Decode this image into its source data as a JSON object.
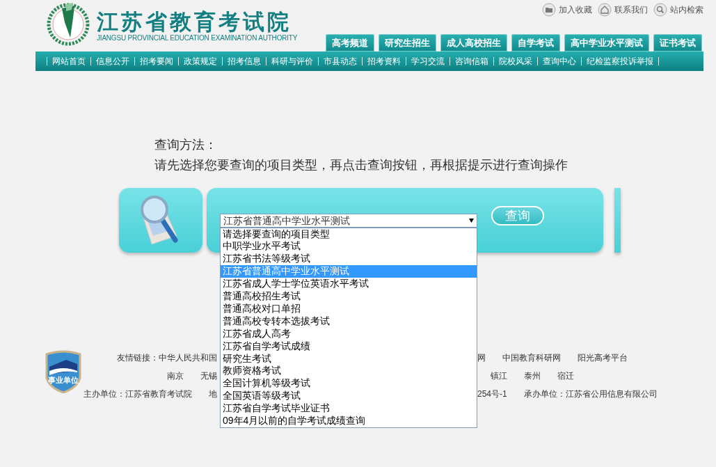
{
  "header": {
    "title": "江苏省教育考试院",
    "subtitle": "JIANGSU PROVINCIAL EDUCATION EXAMINATION AUTHORITY",
    "top_links": [
      {
        "label": "加入收藏",
        "kind": "folder"
      },
      {
        "label": "联系我们",
        "kind": "home"
      },
      {
        "label": "站内检索",
        "kind": "search"
      }
    ],
    "tabs": [
      "高考频道",
      "研究生招生",
      "成人高校招生",
      "自学考试",
      "高中学业水平测试",
      "证书考试"
    ]
  },
  "nav": [
    "网站首页",
    "信息公开",
    "招考要闻",
    "政策规定",
    "招考信息",
    "科研与评价",
    "市县动态",
    "招考资料",
    "学习交流",
    "咨询信箱",
    "院校风采",
    "查询中心",
    "纪检监察投诉举报"
  ],
  "instructions": {
    "heading": "查询方法：",
    "text": "请先选择您要查询的项目类型，再点击查询按钮，再根据提示进行查询操作"
  },
  "query": {
    "select_value": "江苏省普通高中学业水平测试",
    "button": "查询",
    "options": [
      {
        "label": "请选择要查询的项目类型",
        "selected": false
      },
      {
        "label": "中职学业水平考试",
        "selected": false
      },
      {
        "label": "江苏省书法等级考试",
        "selected": false
      },
      {
        "label": "江苏省普通高中学业水平测试",
        "selected": true
      },
      {
        "label": "江苏省成人学士学位英语水平考试",
        "selected": false
      },
      {
        "label": "普通高校招生考试",
        "selected": false
      },
      {
        "label": "普通高校对口单招",
        "selected": false
      },
      {
        "label": "普通高校专转本选拔考试",
        "selected": false
      },
      {
        "label": "江苏省成人高考",
        "selected": false
      },
      {
        "label": "江苏省自学考试成绩",
        "selected": false
      },
      {
        "label": "研究生考试",
        "selected": false
      },
      {
        "label": "教师资格考试",
        "selected": false
      },
      {
        "label": "全国计算机等级考试",
        "selected": false
      },
      {
        "label": "全国英语等级考试",
        "selected": false
      },
      {
        "label": "江苏省自学考试毕业证书",
        "selected": false
      },
      {
        "label": "09年4月以前的自学考试成绩查询",
        "selected": false
      }
    ]
  },
  "footer": {
    "badge_text": "事业单位",
    "rows": [
      {
        "left": [
          "友情链接：中华人民共和国"
        ],
        "right": [
          "网",
          "中国教育科研网",
          "阳光高考平台"
        ]
      },
      {
        "left": [
          "南京",
          "无锡"
        ],
        "right": [
          "镇江",
          "泰州",
          "宿迁"
        ]
      },
      {
        "left": [
          "主办单位：江苏省教育考试院",
          "地"
        ],
        "right": [
          "254号-1",
          "承办单位：江苏省公用信息有限公司"
        ]
      }
    ]
  }
}
